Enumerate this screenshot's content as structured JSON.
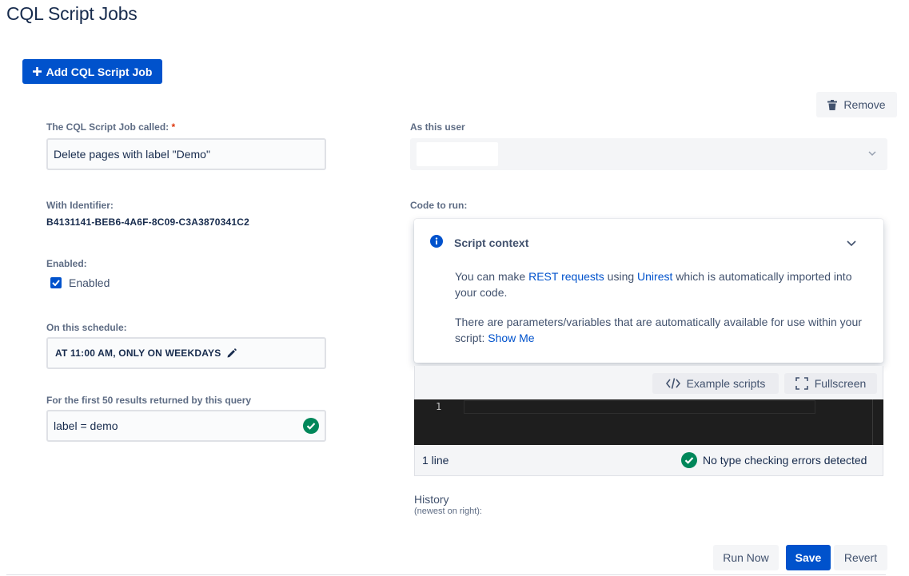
{
  "page": {
    "title": "CQL Script Jobs"
  },
  "add_button": {
    "label": "Add CQL Script Job",
    "icon": "plus-icon"
  },
  "remove_button": {
    "label": "Remove",
    "icon": "trash-icon"
  },
  "job": {
    "name_label": "The CQL Script Job called:",
    "required_mark": "*",
    "name_value": "Delete pages with label \"Demo\"",
    "identifier_label": "With Identifier:",
    "identifier_value": "B4131141-BEB6-4A6F-8C09-C3A3870341C2",
    "enabled_label": "Enabled:",
    "enabled_checkbox_label": "Enabled",
    "enabled": true,
    "schedule_label": "On this schedule:",
    "schedule_value": "AT 11:00 AM, ONLY ON WEEKDAYS",
    "query_label": "For the first 50 results returned by this query",
    "query_value": "label = demo",
    "query_valid": true
  },
  "user": {
    "label": "As this user"
  },
  "code": {
    "label": "Code to run:",
    "context_panel": {
      "title": "Script context",
      "line1_prefix": "You can make ",
      "line1_link1": "REST requests",
      "line1_mid": " using ",
      "line1_link2": "Unirest",
      "line1_suffix": " which is automatically imported into your code.",
      "line2_prefix": "There are parameters/variables that are automatically available for use within your script: ",
      "line2_link": "Show Me"
    },
    "example_scripts_label": "Example scripts",
    "fullscreen_label": "Fullscreen",
    "line_number": "1",
    "line_count": "1 line",
    "type_check_status": "No type checking errors detected"
  },
  "history": {
    "label": "History",
    "sublabel": "(newest on right):"
  },
  "actions": {
    "run_now": "Run Now",
    "save": "Save",
    "revert": "Revert"
  },
  "colors": {
    "primary": "#0052cc",
    "success": "#00875a",
    "editor_bg": "#1e1e1e",
    "required": "#de350b"
  }
}
